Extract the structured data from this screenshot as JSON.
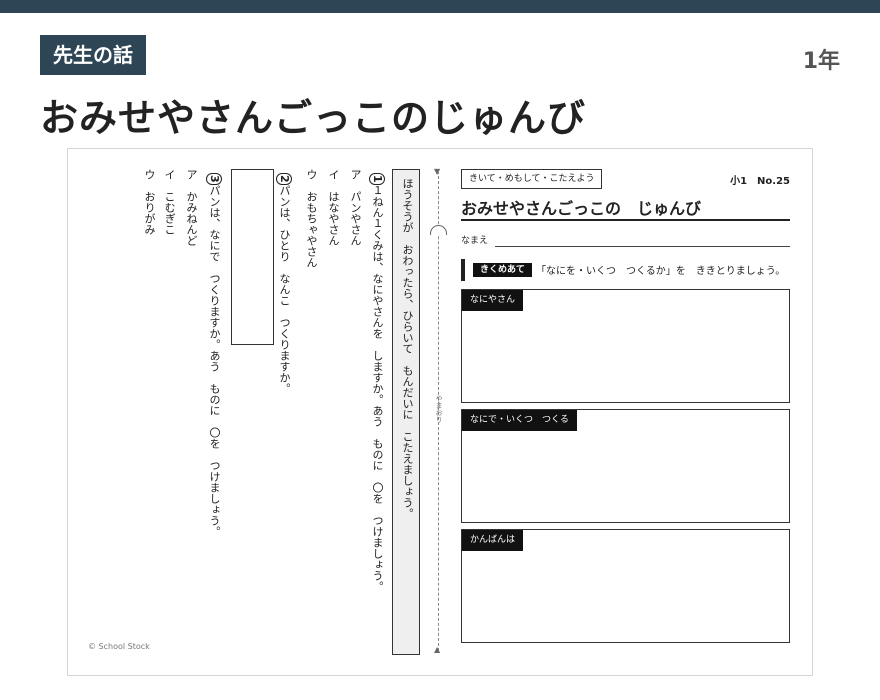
{
  "header": {
    "badge": "先生の話",
    "grade": "1年",
    "title": "おみせやさんごっこのじゅんび"
  },
  "sheet": {
    "instructions": "ほうそうが　おわったら、ひらいて　もんだいに　こたえましょう。",
    "q1": {
      "num": "1",
      "text": "１ねん１くみは、なにやさんを　しますか。あう　ものに　〇を　つけましょう。",
      "options": [
        "ア　パンやさん",
        "イ　はなやさん",
        "ウ　おもちゃやさん"
      ]
    },
    "q2": {
      "num": "2",
      "text": "パンは、ひとり　なんこ　つくりますか。"
    },
    "q3": {
      "num": "3",
      "text": "パンは、なにで　つくりますか。あう　ものに　〇を　つけましょう。",
      "options": [
        "ア　かみねんど",
        "イ　こむぎこ",
        "ウ　おりがみ"
      ]
    },
    "fold_label": "やまおり",
    "copyright": "© School Stock",
    "right": {
      "tag": "きいて・めもして・こたえよう",
      "sheet_no": "小1　No.25",
      "title": "おみせやさんごっこの　じゅんび",
      "name_label": "なまえ",
      "goal_label": "きくめあて",
      "goal_text": "「なにを・いくつ　つくるか」を　ききとりましょう。",
      "boxes": [
        "なにやさん",
        "なにで・いくつ　つくる",
        "かんばんは"
      ]
    }
  }
}
